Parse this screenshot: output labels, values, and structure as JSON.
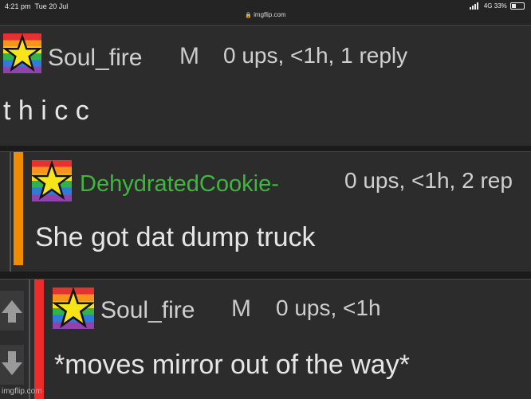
{
  "status_bar": {
    "time": "4:21 pm",
    "date": "Tue 20 Jul",
    "url": "imgflip.com",
    "network": "4G",
    "battery": "33%"
  },
  "comments": [
    {
      "username": "Soul_fire",
      "gender": "M",
      "meta": "0 ups, <1h, 1 reply",
      "text": "t h i c c",
      "username_color": "#cfcfcf"
    },
    {
      "username": "DehydratedCookie-",
      "meta": "0 ups, <1h, 2 rep",
      "text": "She got dat dump truck",
      "username_color": "#3db83d",
      "accent_color": "#f08c00"
    },
    {
      "username": "Soul_fire",
      "gender": "M",
      "meta": "0 ups, <1h",
      "text": "*moves mirror out of the way*",
      "username_color": "#cfcfcf",
      "accent_color": "#ee2b2b"
    }
  ],
  "icons": {
    "upvote": "arrow-up-icon",
    "downvote": "arrow-down-icon",
    "avatar": "pride-star-flag-icon"
  },
  "watermark": "imgflip.com"
}
